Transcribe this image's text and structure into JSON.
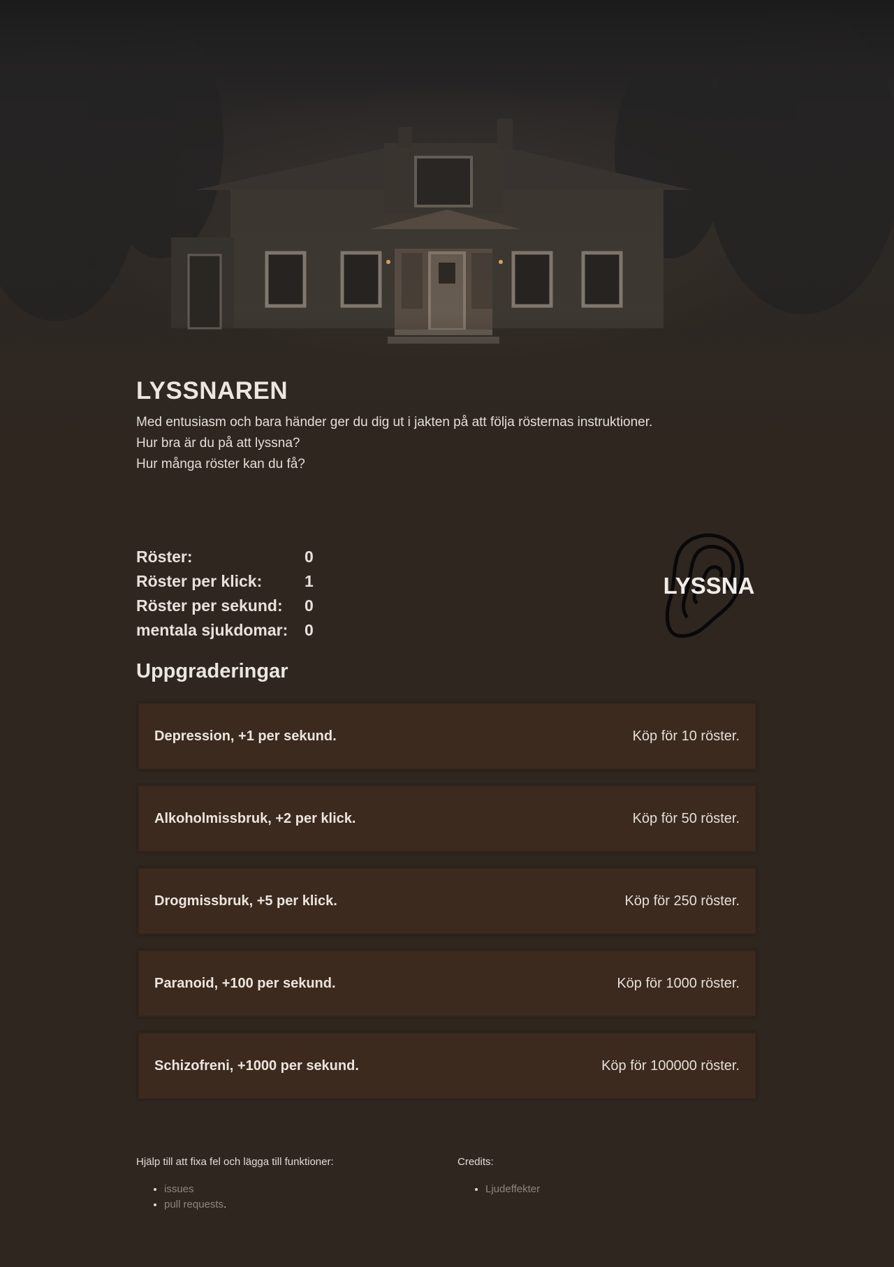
{
  "header": {
    "title": "LYSSNAREN",
    "intro": [
      "Med entusiasm och bara händer ger du dig ut i jakten på att följa rösternas instruktioner.",
      "Hur bra är du på att lyssna?",
      "Hur många röster kan du få?"
    ]
  },
  "stats": [
    {
      "label": "Röster:",
      "value": "0"
    },
    {
      "label": "Röster per klick:",
      "value": "1"
    },
    {
      "label": "Röster per sekund:",
      "value": "0"
    },
    {
      "label": "mentala sjukdomar:",
      "value": "0"
    }
  ],
  "listen": {
    "label": "LYSSNA",
    "icon": "ear-icon"
  },
  "upgrades_title": "Uppgraderingar",
  "upgrades": [
    {
      "name": "Depression, +1 per sekund.",
      "cost": "Köp för 10 röster."
    },
    {
      "name": "Alkoholmissbruk, +2 per klick.",
      "cost": "Köp för 50 röster."
    },
    {
      "name": "Drogmissbruk, +5 per klick.",
      "cost": "Köp för 250 röster."
    },
    {
      "name": "Paranoid, +100 per sekund.",
      "cost": "Köp för 1000 röster."
    },
    {
      "name": "Schizofreni, +1000 per sekund.",
      "cost": "Köp för 100000 röster."
    }
  ],
  "footer": {
    "help_heading": "Hjälp till att fixa fel och lägga till funktioner:",
    "help_links": [
      "issues",
      "pull requests"
    ],
    "help_suffix": ".",
    "credits_heading": "Credits:",
    "credits_links": [
      "Ljudeffekter"
    ]
  },
  "colors": {
    "background": "#2f2620",
    "upgrade_card": "#3b2a1d",
    "text": "#e8e1dc",
    "link": "#8e857e"
  }
}
